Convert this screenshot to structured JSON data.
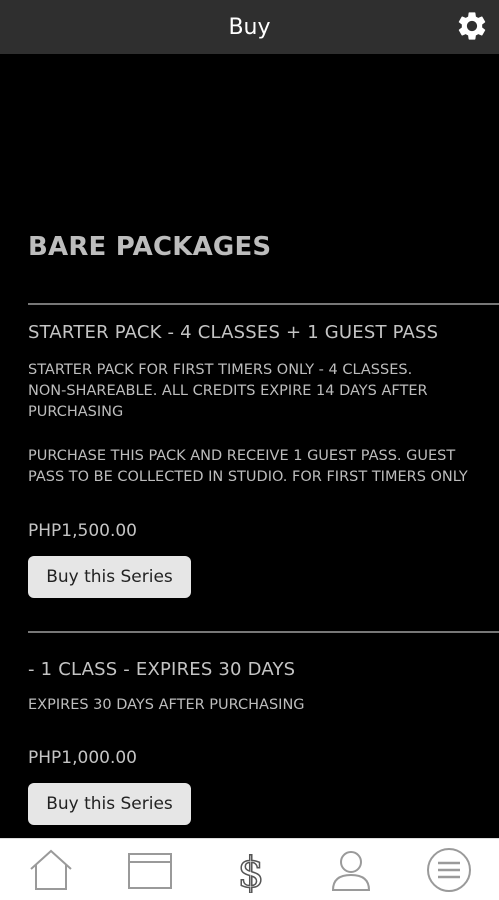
{
  "header": {
    "title": "Buy",
    "settings_icon": "gear-icon"
  },
  "section": {
    "title": "BARE PACKAGES"
  },
  "packages": [
    {
      "name": "STARTER PACK - 4 CLASSES + 1 GUEST PASS",
      "description_lines": [
        "STARTER PACK FOR FIRST TIMERS ONLY - 4 CLASSES.",
        "NON-SHAREABLE. ALL CREDITS EXPIRE 14 DAYS AFTER",
        "PURCHASING"
      ],
      "description2_lines": [
        "PURCHASE THIS PACK AND RECEIVE 1 GUEST PASS. GUEST",
        "PASS TO BE COLLECTED IN STUDIO. FOR FIRST TIMERS ONLY"
      ],
      "price": "PHP1,500.00",
      "button_label": "Buy this Series"
    },
    {
      "name": "- 1 CLASS - EXPIRES 30 DAYS",
      "description_lines": [
        "EXPIRES 30 DAYS AFTER PURCHASING"
      ],
      "price": "PHP1,000.00",
      "button_label": "Buy this Series"
    }
  ],
  "bottom_nav": [
    {
      "icon": "home-icon"
    },
    {
      "icon": "calendar-icon"
    },
    {
      "icon": "dollar-icon"
    },
    {
      "icon": "user-icon"
    },
    {
      "icon": "menu-icon"
    }
  ],
  "colors": {
    "background": "#000000",
    "header_bg": "#2f2f2f",
    "text": "#c4c4c4",
    "button_bg": "#e6e6e6",
    "nav_icon": "#9a9a9a"
  }
}
